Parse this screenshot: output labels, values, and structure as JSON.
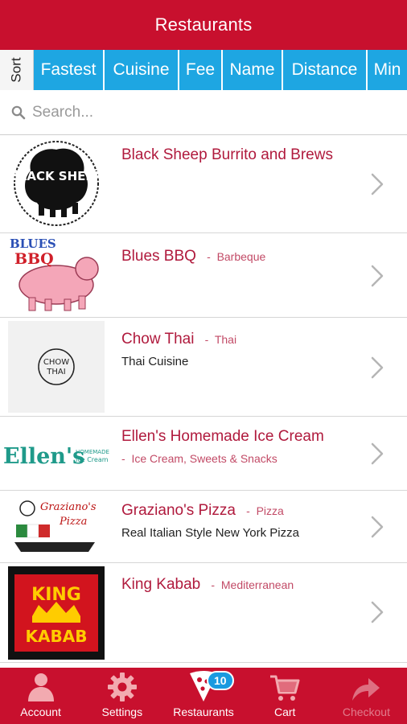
{
  "header": {
    "title": "Restaurants"
  },
  "sort": {
    "label": "Sort",
    "options": [
      "Fastest",
      "Cuisine",
      "Fee",
      "Name",
      "Distance",
      "Min"
    ]
  },
  "search": {
    "placeholder": "Search..."
  },
  "restaurants": [
    {
      "name": "Black Sheep Burrito and Brews",
      "category": "",
      "description": "",
      "logo": "black-sheep-logo",
      "logo_text": "BLACK SHEEP"
    },
    {
      "name": "Blues BBQ",
      "category": "Barbeque",
      "description": "",
      "logo": "blues-bbq-logo",
      "logo_text": [
        "BLUES",
        "BBQ"
      ]
    },
    {
      "name": "Chow Thai",
      "category": "Thai",
      "description": "Thai Cuisine",
      "logo": "chow-thai-logo",
      "logo_text": [
        "CHOW",
        "THAI"
      ]
    },
    {
      "name": "Ellen's Homemade Ice Cream",
      "category": "Ice Cream, Sweets & Snacks",
      "description": "",
      "logo": "ellens-logo",
      "logo_text": [
        "Ellen's",
        "HOMEMADE",
        "Ice Cream"
      ]
    },
    {
      "name": "Graziano's Pizza",
      "category": "Pizza",
      "description": "Real Italian Style New York Pizza",
      "logo": "grazianos-logo",
      "logo_text": [
        "Graziano's",
        "Pizza"
      ]
    },
    {
      "name": "King Kabab",
      "category": "Mediterranean",
      "description": "",
      "logo": "king-kabab-logo",
      "logo_text": [
        "KING",
        "KABAB"
      ]
    }
  ],
  "tabbar": {
    "items": [
      {
        "label": "Account",
        "icon": "person-icon",
        "enabled": true
      },
      {
        "label": "Settings",
        "icon": "gear-icon",
        "enabled": true
      },
      {
        "label": "Restaurants",
        "icon": "pizza-slice-icon",
        "enabled": true,
        "badge": "10"
      },
      {
        "label": "Cart",
        "icon": "cart-icon",
        "enabled": true
      },
      {
        "label": "Checkout",
        "icon": "forward-arrow-icon",
        "enabled": false
      }
    ]
  },
  "colors": {
    "header_red": "#c8102e",
    "tab_blue": "#1ea6e2",
    "name_red": "#b01a3d",
    "badge_blue": "#1a9ae0"
  }
}
